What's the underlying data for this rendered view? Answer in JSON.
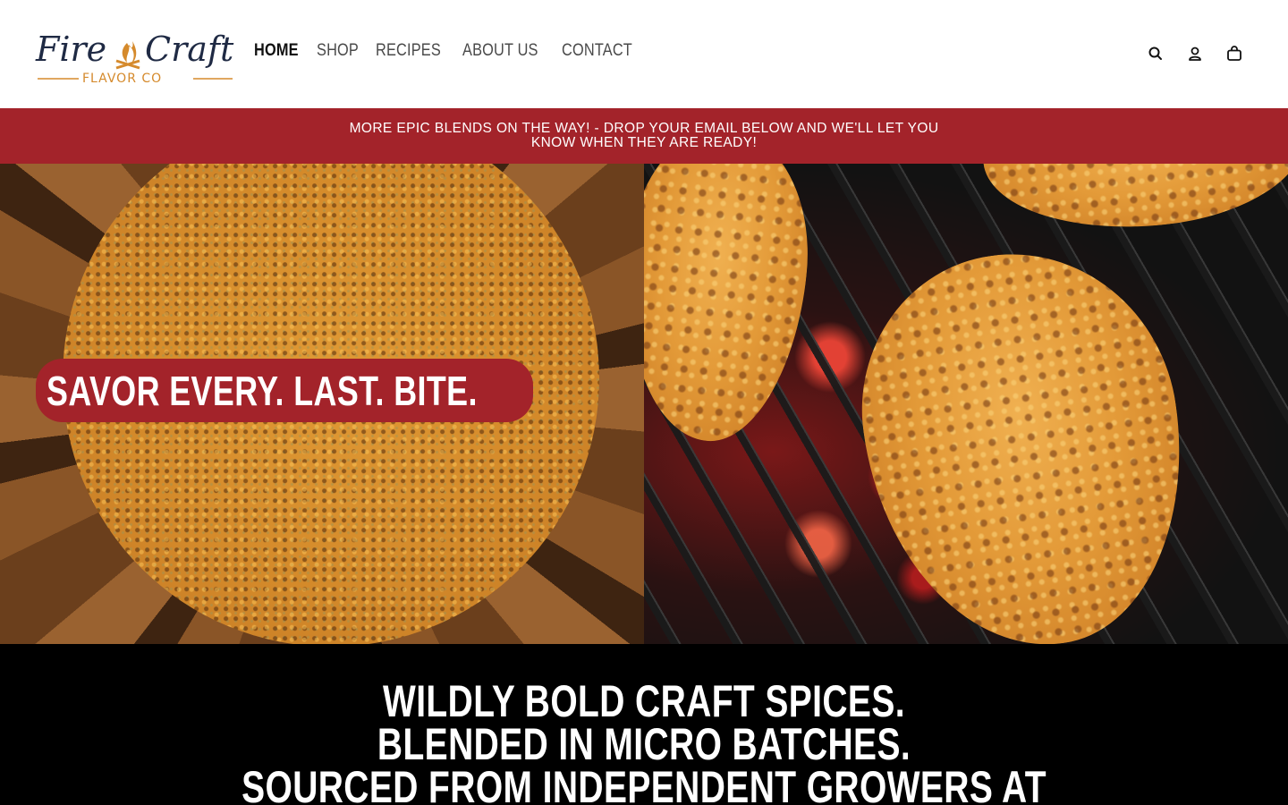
{
  "brand": {
    "logo_line1_a": "Fire",
    "logo_line1_b": "Craft",
    "logo_line2": "FLAVOR CO",
    "colors": {
      "navy": "#1f2a44",
      "flame": "#d58a2c",
      "red": "#a3232a"
    }
  },
  "nav": {
    "items": [
      {
        "label": "HOME"
      },
      {
        "label": "SHOP"
      },
      {
        "label": "RECIPES"
      },
      {
        "label": "ABOUT US"
      },
      {
        "label": "CONTACT"
      }
    ]
  },
  "header_icons": [
    "search-icon",
    "account-icon",
    "cart-icon"
  ],
  "announcement": {
    "text": "MORE EPIC BLENDS ON THE WAY! - DROP YOUR EMAIL BELOW AND WE'LL LET YOU KNOW WHEN THEY ARE READY!"
  },
  "hero": {
    "tagline": "SAVOR EVERY. LAST. BITE."
  },
  "intro": {
    "lines": [
      "WILDLY BOLD CRAFT SPICES.",
      "BLENDED IN MICRO BATCHES.",
      "SOURCED FROM INDEPENDENT GROWERS AT"
    ]
  }
}
